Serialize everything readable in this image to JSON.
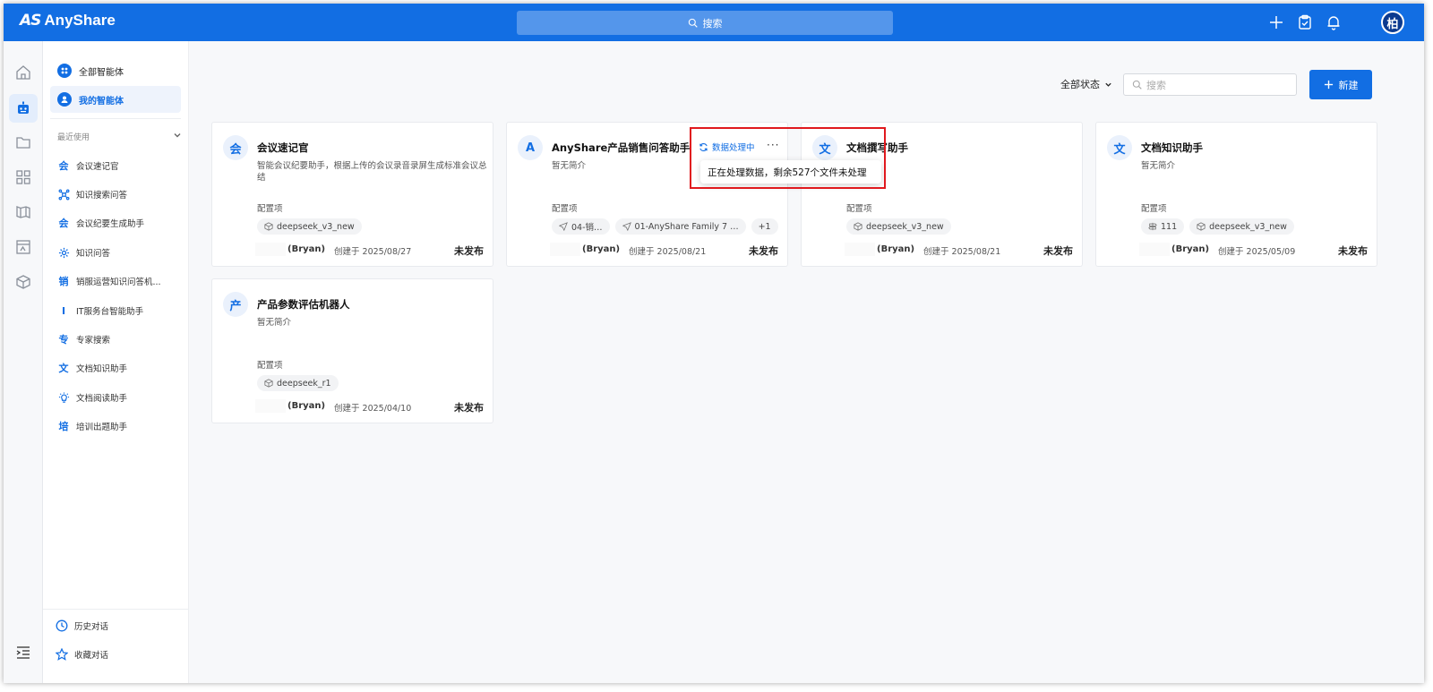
{
  "header": {
    "brand_mark": "AS",
    "brand_name": "AnyShare",
    "search_placeholder": "搜索",
    "avatar_initial": "柏"
  },
  "sidebar": {
    "all_agents": "全部智能体",
    "my_agents": "我的智能体",
    "recent_label": "最近使用",
    "recent": [
      {
        "icon": "会",
        "label": "会议速记官"
      },
      {
        "icon": "network-icon",
        "label": "知识搜索问答"
      },
      {
        "icon": "会",
        "label": "会议纪要生成助手"
      },
      {
        "icon": "gear-icon",
        "label": "知识问答"
      },
      {
        "icon": "销",
        "label": "销服运营知识问答机..."
      },
      {
        "icon": "I",
        "label": "IT服务台智能助手"
      },
      {
        "icon": "专",
        "label": "专家搜索"
      },
      {
        "icon": "文",
        "label": "文档知识助手"
      },
      {
        "icon": "bulb-icon",
        "label": "文档阅读助手"
      },
      {
        "icon": "培",
        "label": "培训出题助手"
      }
    ],
    "history": "历史对话",
    "favorites": "收藏对话"
  },
  "toolbar": {
    "status_filter": "全部状态",
    "search_placeholder": "搜索",
    "new_button": "新建"
  },
  "cards": [
    {
      "avatar": "会",
      "title": "会议速记官",
      "desc": "智能会议纪要助手，根据上传的会议录音录屏生成标准会议总结",
      "config_label": "配置项",
      "tags": [
        "deepseek_v3_new"
      ],
      "owner": "(Bryan)",
      "created": "创建于 2025/08/27",
      "status": "未发布"
    },
    {
      "avatar": "A",
      "title": "AnyShare产品销售问答助手",
      "desc": "暂无简介",
      "config_label": "配置项",
      "tags": [
        "04-销…",
        "01-AnyShare Family 7 …",
        "+1"
      ],
      "owner": "(Bryan)",
      "created": "创建于 2025/08/21",
      "status": "未发布",
      "processing": "数据处理中",
      "more": "···"
    },
    {
      "avatar": "文",
      "title": "文档撰写助手",
      "desc": "",
      "config_label": "配置项",
      "tags": [
        "deepseek_v3_new"
      ],
      "owner": "(Bryan)",
      "created": "创建于 2025/08/21",
      "status": "未发布"
    },
    {
      "avatar": "文",
      "title": "文档知识助手",
      "desc": "暂无简介",
      "config_label": "配置项",
      "tags": [
        "111",
        "deepseek_v3_new"
      ],
      "owner": "(Bryan)",
      "created": "创建于 2025/05/09",
      "status": "未发布"
    },
    {
      "avatar": "产",
      "title": "产品参数评估机器人",
      "desc": "暂无简介",
      "config_label": "配置项",
      "tags": [
        "deepseek_r1"
      ],
      "owner": "(Bryan)",
      "created": "创建于 2025/04/10",
      "status": "未发布"
    }
  ],
  "tooltip": "正在处理数据，剩余527个文件未处理",
  "colors": {
    "primary": "#126ee3",
    "highlight": "#e0191e"
  }
}
